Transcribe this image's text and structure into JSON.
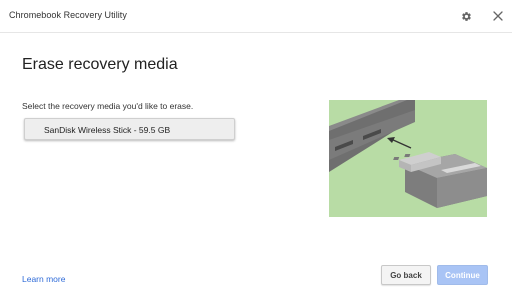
{
  "window": {
    "title": "Chromebook Recovery Utility",
    "settings_icon": "gear-icon",
    "close_icon": "close-icon"
  },
  "main": {
    "heading": "Erase recovery media",
    "instruction": "Select the recovery media you'd like to erase.",
    "media_option": "SanDisk Wireless Stick - 59.5 GB"
  },
  "illustration": {
    "description_icon": "usb-insert-illustration",
    "background_color": "#b8dca5"
  },
  "footer": {
    "learn_more": "Learn more",
    "back_label": "Go back",
    "continue_label": "Continue",
    "continue_enabled": false
  },
  "colors": {
    "link": "#2f6bd8",
    "primary_disabled": "#a9c4f5"
  }
}
